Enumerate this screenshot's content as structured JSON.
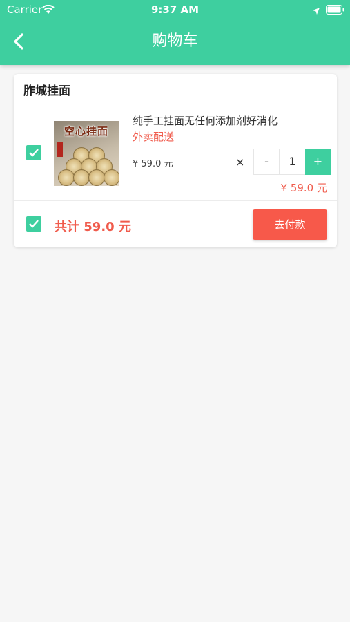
{
  "status_bar": {
    "carrier": "Carrier",
    "time": "9:37 AM"
  },
  "header": {
    "title": "购物车",
    "back_icon": "chevron-left-icon"
  },
  "cart": {
    "store_name": "胙城挂面",
    "item": {
      "checked": true,
      "image_text": "空心挂面",
      "name": "纯手工挂面无任何添加剂好消化",
      "delivery_tag": "外卖配送",
      "unit_price": "¥ 59.0 元",
      "times_sign": "×",
      "minus_label": "-",
      "quantity": "1",
      "plus_label": "+",
      "subtotal": "¥ 59.0 元"
    },
    "footer": {
      "select_all_checked": true,
      "total_label": "共计 59.0 元",
      "pay_button_label": "去付款"
    }
  },
  "colors": {
    "primary": "#3ecf9f",
    "accent_red": "#f05b4c",
    "pay_button": "#f7594a",
    "background": "#f6f6f6"
  }
}
